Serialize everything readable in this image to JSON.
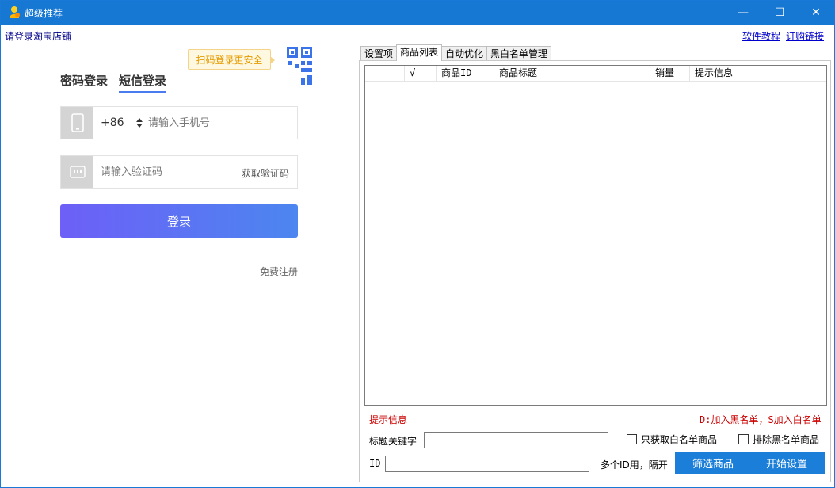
{
  "window": {
    "title": "超级推荐",
    "minimize_glyph": "—",
    "maximize_glyph": "☐",
    "close_glyph": "✕"
  },
  "header": {
    "login_hint": "请登录淘宝店铺",
    "tutorial_link": "软件教程",
    "buy_link": "订购链接"
  },
  "login": {
    "qr_tip": "扫码登录更安全",
    "tabs": [
      "密码登录",
      "短信登录"
    ],
    "active_tab": "短信登录",
    "country_code": "+86",
    "phone_placeholder": "请输入手机号",
    "code_placeholder": "请输入验证码",
    "get_code_label": "获取验证码",
    "login_button": "登录",
    "register_link": "免费注册"
  },
  "right_panel": {
    "tabs": [
      "设置项",
      "商品列表",
      "自动优化",
      "黑白名单管理"
    ],
    "active_tab": "商品列表",
    "list_columns": [
      "",
      "√",
      "商品ID",
      "商品标题",
      "销量",
      "提示信息"
    ],
    "hint_label": "提示信息",
    "hotkey_hint": "D:加入黑名单，S加入白名单",
    "keyword_label": "标题关键字",
    "keyword_value": "",
    "whitelist_only_label": "只获取白名单商品",
    "exclude_blacklist_label": "排除黑名单商品",
    "id_label": "ID",
    "id_value": "",
    "id_hint": "多个ID用，隔开",
    "filter_button": "筛选商品",
    "start_button": "开始设置"
  },
  "colors": {
    "titlebar": "#1778d3",
    "accent_blue": "#1b7ed8",
    "hint_red": "#cc0000",
    "login_gradient_start": "#6d5ff7",
    "login_gradient_end": "#4c86f0"
  }
}
